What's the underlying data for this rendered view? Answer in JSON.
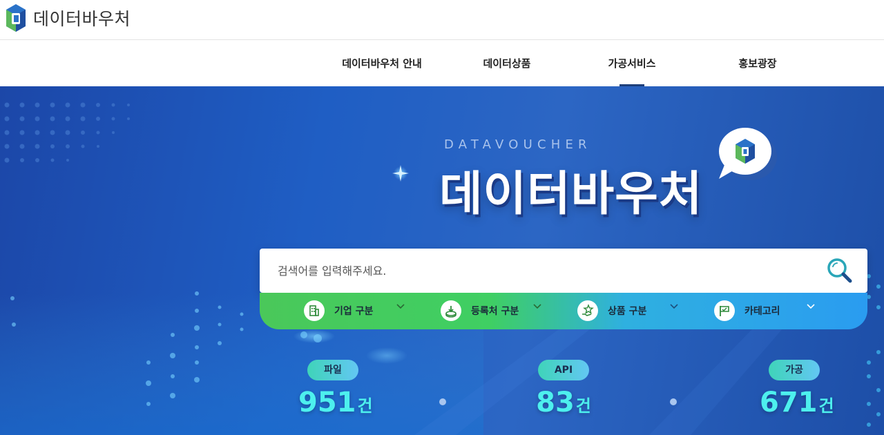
{
  "brand": {
    "name": "데이터바우처"
  },
  "nav": {
    "items": [
      {
        "label": "데이터바우처 안내",
        "active": false
      },
      {
        "label": "데이터상품",
        "active": false
      },
      {
        "label": "가공서비스",
        "active": true
      },
      {
        "label": "홍보광장",
        "active": false
      }
    ]
  },
  "hero": {
    "subtitle": "DATAVOUCHER",
    "title": "데이터바우처"
  },
  "search": {
    "placeholder": "검색어를 입력해주세요."
  },
  "filters": [
    {
      "label": "기업 구분",
      "icon": "building-icon"
    },
    {
      "label": "등록처 구분",
      "icon": "registry-icon"
    },
    {
      "label": "상품 구분",
      "icon": "product-star-icon"
    },
    {
      "label": "카테고리",
      "icon": "flag-icon"
    }
  ],
  "stats": [
    {
      "label": "파일",
      "value": "951",
      "unit": "건"
    },
    {
      "label": "API",
      "value": "83",
      "unit": "건"
    },
    {
      "label": "가공",
      "value": "671",
      "unit": "건"
    }
  ],
  "colors": {
    "accent": "#1e3f7a",
    "hero_blue": "#1f5ec4",
    "filter_green": "#4ac85a",
    "filter_blue": "#2a9cf0",
    "stat_number": "#4df0ee"
  }
}
